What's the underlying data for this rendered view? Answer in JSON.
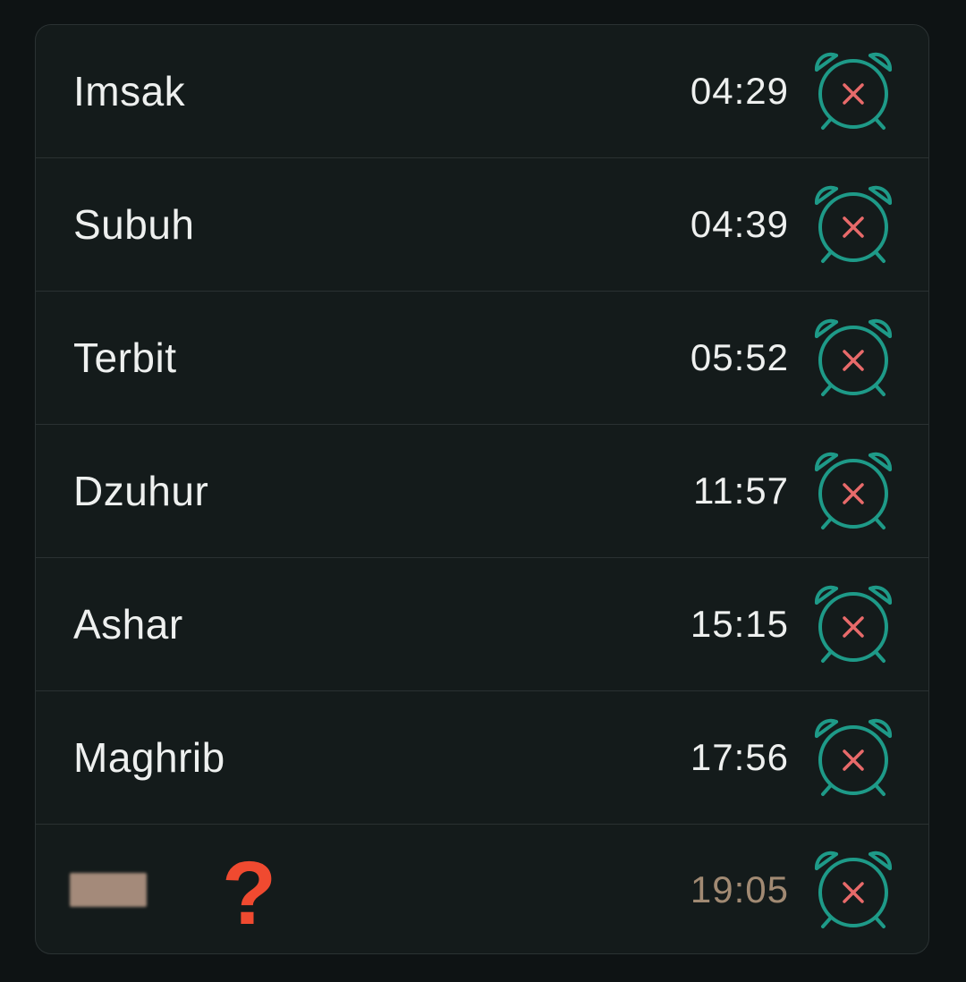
{
  "prayers": [
    {
      "name": "Imsak",
      "time": "04:29",
      "alarm_icon": "alarm-off-icon"
    },
    {
      "name": "Subuh",
      "time": "04:39",
      "alarm_icon": "alarm-off-icon"
    },
    {
      "name": "Terbit",
      "time": "05:52",
      "alarm_icon": "alarm-off-icon"
    },
    {
      "name": "Dzuhur",
      "time": "11:57",
      "alarm_icon": "alarm-off-icon"
    },
    {
      "name": "Ashar",
      "time": "15:15",
      "alarm_icon": "alarm-off-icon"
    },
    {
      "name": "Maghrib",
      "time": "17:56",
      "alarm_icon": "alarm-off-icon"
    },
    {
      "name": "",
      "time": "19:05",
      "alarm_icon": "alarm-off-icon",
      "annotation": "?"
    }
  ],
  "colors": {
    "alarm_ring": "#1e9a88",
    "alarm_x": "#e86a6a",
    "last_time": "#a18a73",
    "annotation": "#f04a30"
  }
}
